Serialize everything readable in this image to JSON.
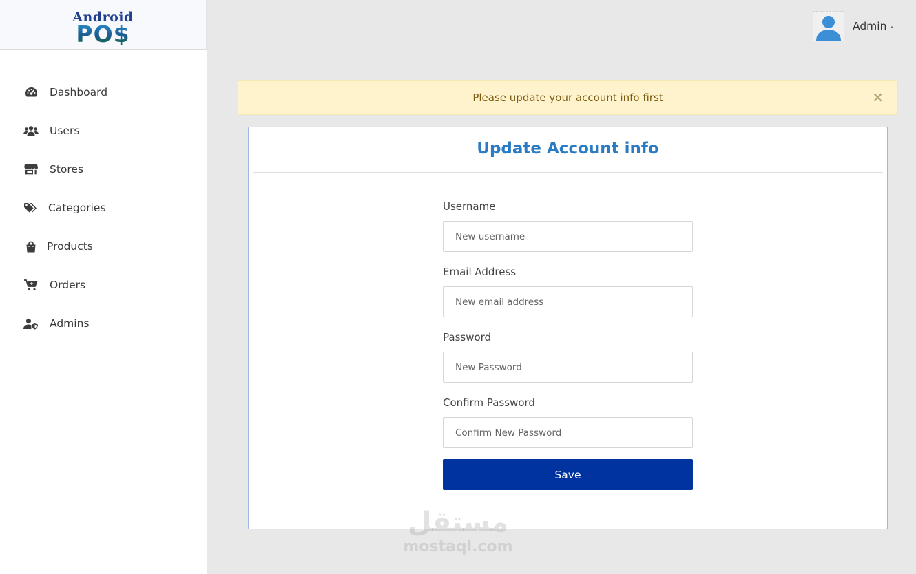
{
  "logo": {
    "top_text": "Android",
    "bottom_text": "PO$"
  },
  "sidebar": {
    "items": [
      {
        "label": "Dashboard",
        "icon": "dashboard-icon"
      },
      {
        "label": "Users",
        "icon": "users-icon"
      },
      {
        "label": "Stores",
        "icon": "store-icon"
      },
      {
        "label": "Categories",
        "icon": "tags-icon"
      },
      {
        "label": "Products",
        "icon": "shopping-bag-icon"
      },
      {
        "label": "Orders",
        "icon": "cart-icon"
      },
      {
        "label": "Admins",
        "icon": "user-shield-icon"
      }
    ]
  },
  "header": {
    "user_name": "Admin",
    "caret": "⌄"
  },
  "alert": {
    "message": "Please update your account info first",
    "close_glyph": "×"
  },
  "form": {
    "title": "Update Account info",
    "username_label": "Username",
    "username_placeholder": "New username",
    "email_label": "Email Address",
    "email_placeholder": "New email address",
    "password_label": "Password",
    "password_placeholder": "New Password",
    "confirm_label": "Confirm Password",
    "confirm_placeholder": "Confirm New Password",
    "save_label": "Save"
  },
  "watermark": {
    "arabic": "مستقل",
    "latin": "mostaql.com"
  },
  "colors": {
    "accent": "#2a7bc2",
    "primary_button": "#0033a0",
    "alert_bg": "#fff3cd",
    "page_bg": "#e8e8e8"
  }
}
